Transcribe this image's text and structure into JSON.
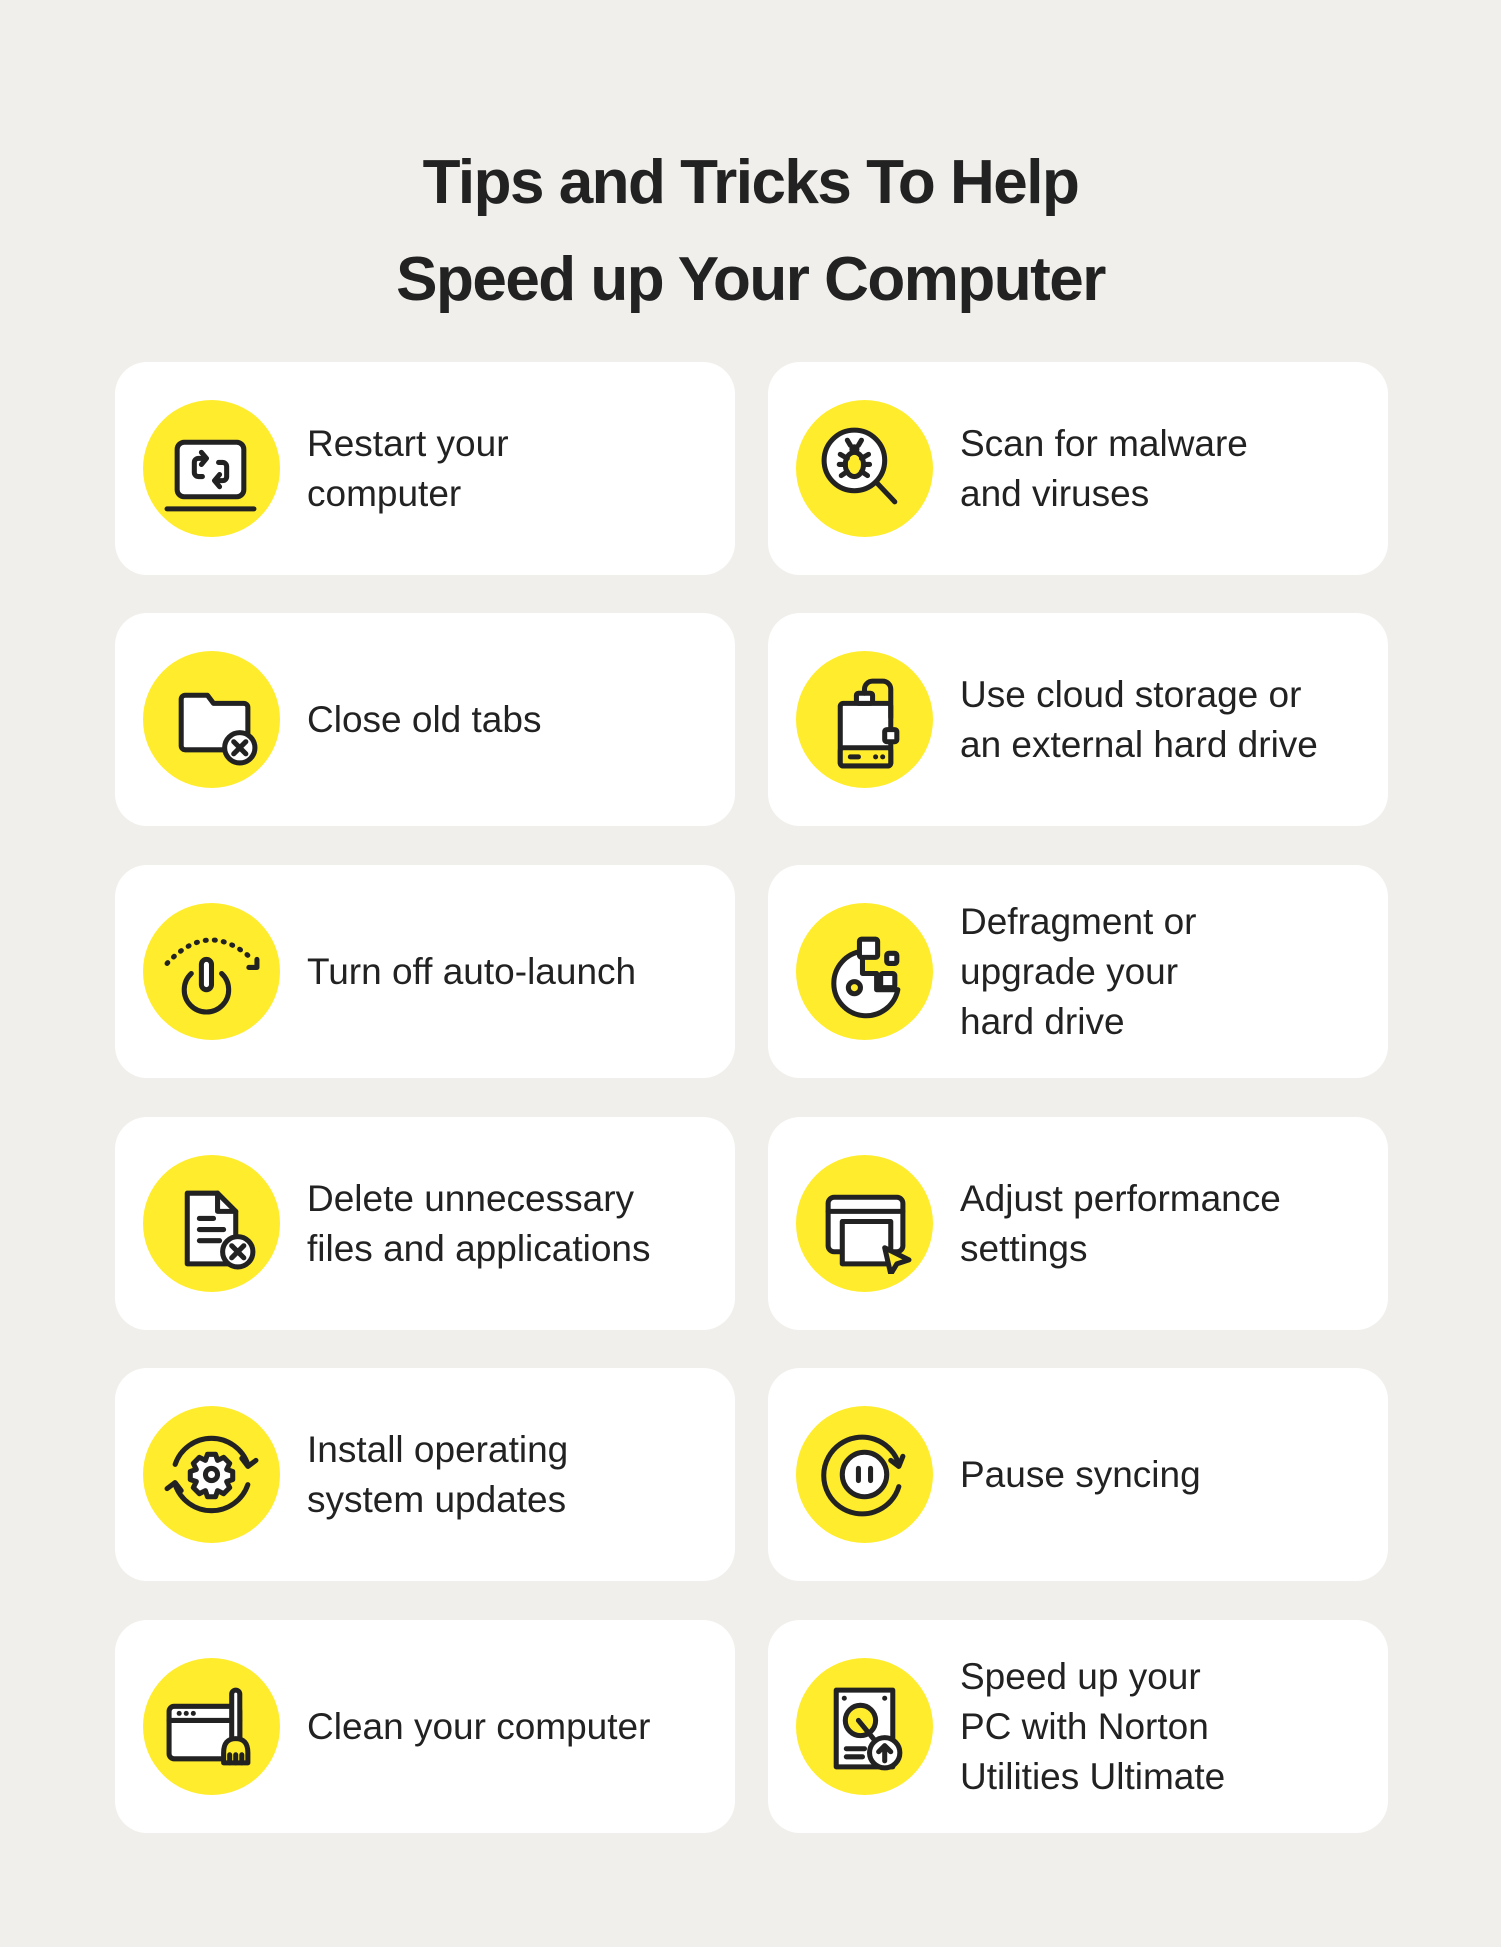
{
  "title": {
    "line1": "Tips and Tricks To Help",
    "line2": "Speed up Your Computer"
  },
  "colors": {
    "background": "#f0efeb",
    "card": "#ffffff",
    "accent": "#ffec2d",
    "text": "#222222"
  },
  "tips": [
    {
      "label": "Restart your\ncomputer",
      "icon": "laptop-restart-icon"
    },
    {
      "label": "Scan for malware\nand viruses",
      "icon": "bug-magnifier-icon"
    },
    {
      "label": "Close old tabs",
      "icon": "folder-close-icon"
    },
    {
      "label": "Use cloud storage or\nan external hard drive",
      "icon": "external-drive-icon"
    },
    {
      "label": "Turn off auto-launch",
      "icon": "power-auto-icon"
    },
    {
      "label": "Defragment or\nupgrade your\nhard drive",
      "icon": "disk-defrag-icon"
    },
    {
      "label": "Delete unnecessary\nfiles and applications",
      "icon": "file-delete-icon"
    },
    {
      "label": "Adjust performance\nsettings",
      "icon": "window-cursor-icon"
    },
    {
      "label": "Install operating\nsystem updates",
      "icon": "gear-update-icon"
    },
    {
      "label": "Pause syncing",
      "icon": "pause-sync-icon"
    },
    {
      "label": "Clean your computer",
      "icon": "browser-broom-icon"
    },
    {
      "label": "Speed up your\nPC with Norton\nUtilities Ultimate",
      "icon": "hard-drive-upgrade-icon"
    }
  ]
}
